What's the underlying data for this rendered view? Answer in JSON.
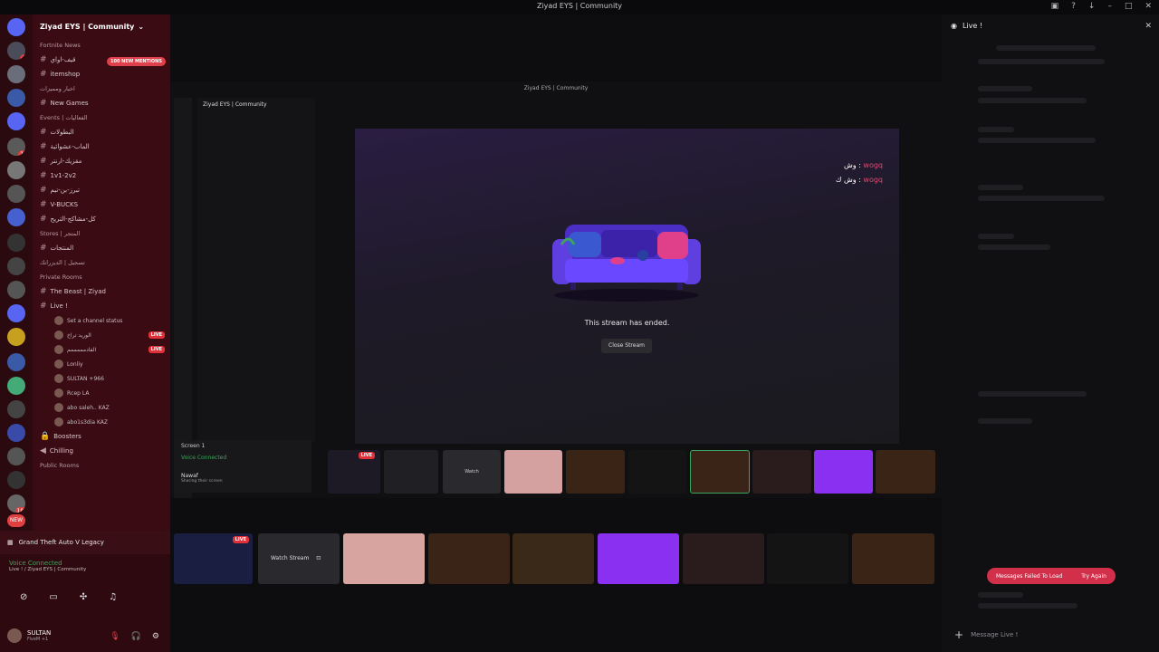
{
  "window": {
    "title": "Ziyad EYS | Community"
  },
  "server": {
    "name": "Ziyad EYS | Community",
    "mentions": "100 NEW MENTIONS"
  },
  "channels": [
    {
      "type": "cat",
      "label": "Fortnite News"
    },
    {
      "type": "ch",
      "label": "قيف-اواي"
    },
    {
      "type": "ch",
      "label": "itemshop"
    },
    {
      "type": "cat",
      "label": "اخبار ومميزات"
    },
    {
      "type": "ch",
      "label": "New  Games"
    },
    {
      "type": "cat",
      "label": "Events | الفعاليات"
    },
    {
      "type": "ch",
      "label": "البطولات"
    },
    {
      "type": "ch",
      "label": "الماب-عشوائية"
    },
    {
      "type": "ch",
      "label": "مقزيك-ارنتر"
    },
    {
      "type": "ch",
      "label": "1v1-2v2"
    },
    {
      "type": "ch",
      "label": "تبرز-بن-تيم"
    },
    {
      "type": "ch",
      "label": "V-BUCKS"
    },
    {
      "type": "ch",
      "label": "كل-مشاكج-التريح"
    },
    {
      "type": "cat",
      "label": "Stores | المتجر"
    },
    {
      "type": "ch",
      "label": "المنتجات"
    },
    {
      "type": "cat",
      "label": "تسجيل | الديزرانك"
    },
    {
      "type": "cat",
      "label": "Private Rooms"
    },
    {
      "type": "ch",
      "label": "The Beast | Ziyad"
    },
    {
      "type": "ch",
      "label": "Live !"
    }
  ],
  "voice_users": [
    {
      "name": "Set a channel status",
      "live": ""
    },
    {
      "name": "الوريد تراخ",
      "live": "LIVE"
    },
    {
      "name": "الفادمممممم",
      "live": "LIVE"
    },
    {
      "name": "Lonliy",
      "live": ""
    },
    {
      "name": "SULTAN +966",
      "live": ""
    },
    {
      "name": "Rcep LA",
      "live": ""
    },
    {
      "name": "abo saleh.. KAZ",
      "live": ""
    },
    {
      "name": "abo1s3dia KAZ",
      "live": ""
    }
  ],
  "extra_channels": [
    "Boosters",
    "Chilling",
    "Public Rooms",
    "Grand Theft Auto V Legacy"
  ],
  "voice": {
    "status": "Voice Connected",
    "channel": "Live ! / Ziyad EYS | Community",
    "user": "SULTAN",
    "sub": "FiveM +1"
  },
  "stream": {
    "ended_text": "This stream has ended.",
    "close_label": "Close Stream",
    "chat": [
      {
        "name": "wogq",
        "text": "وش"
      },
      {
        "name": "wogq",
        "text": "وش ك"
      }
    ]
  },
  "tiles": {
    "watch": "Watch Stream",
    "watch_small": "Watch",
    "screen": "Screen 1"
  },
  "right": {
    "header": "Live !",
    "fail_text": "Messages Failed To Load",
    "retry": "Try Again",
    "placeholder": "Message  Live !"
  },
  "inner": {
    "title": "Ziyad EYS | Community",
    "voice": "Voice Connected",
    "user": "Nawaf",
    "sub": "Sharing their screen"
  }
}
